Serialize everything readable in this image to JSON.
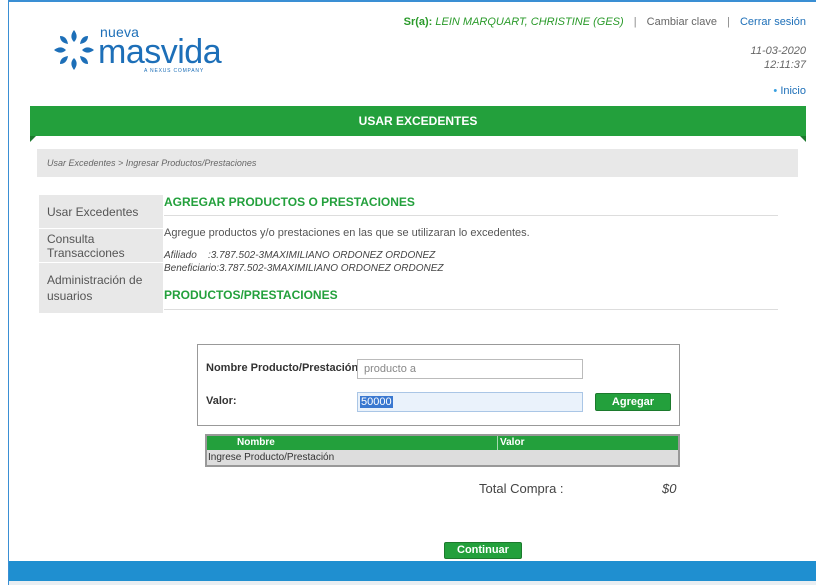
{
  "header": {
    "logo": {
      "nueva": "nueva",
      "masvida": "masvida",
      "tagline": "A NEXUS COMPANY"
    },
    "user_prefix": "Sr(a):",
    "user_name": "LEIN MARQUART, CHRISTINE (GES)",
    "change_password": "Cambiar clave",
    "logout": "Cerrar sesión",
    "separator": "|",
    "date": "11-03-2020",
    "time": "12:11:37",
    "home_link": "Inicio",
    "home_bullet": "•"
  },
  "banner": {
    "title": "USAR EXCEDENTES"
  },
  "breadcrumb": "Usar Excedentes > Ingresar Productos/Prestaciones",
  "sidebar": {
    "items": [
      {
        "label": "Usar Excedentes"
      },
      {
        "label": "Consulta Transacciones"
      },
      {
        "label": "Administración de usuarios"
      }
    ]
  },
  "main": {
    "section_title": "AGREGAR PRODUCTOS O PRESTACIONES",
    "description": "Agregue productos y/o prestaciones en las que se utilizaran lo excedentes.",
    "affiliate_label": "Afiliado",
    "affiliate_value": ":3.787.502-3MAXIMILIANO ORDONEZ ORDONEZ",
    "beneficiary_label": "Beneficiario:",
    "beneficiary_value": "3.787.502-3MAXIMILIANO ORDONEZ ORDONEZ",
    "products_title": "PRODUCTOS/PRESTACIONES"
  },
  "form": {
    "product_label": "Nombre Producto/Prestación :",
    "product_value": "producto a",
    "value_label": "Valor:",
    "value_value": "50000",
    "add_button": "Agregar"
  },
  "table": {
    "columns": [
      "Nombre",
      "Valor"
    ],
    "empty_row": "Ingrese Producto/Prestación"
  },
  "total": {
    "label": "Total Compra :",
    "value": "$0"
  },
  "continue_button": "Continuar",
  "colors": {
    "brand_green": "#23a03c",
    "brand_blue": "#1d6fb8",
    "footer_blue": "#1f8fd0"
  }
}
